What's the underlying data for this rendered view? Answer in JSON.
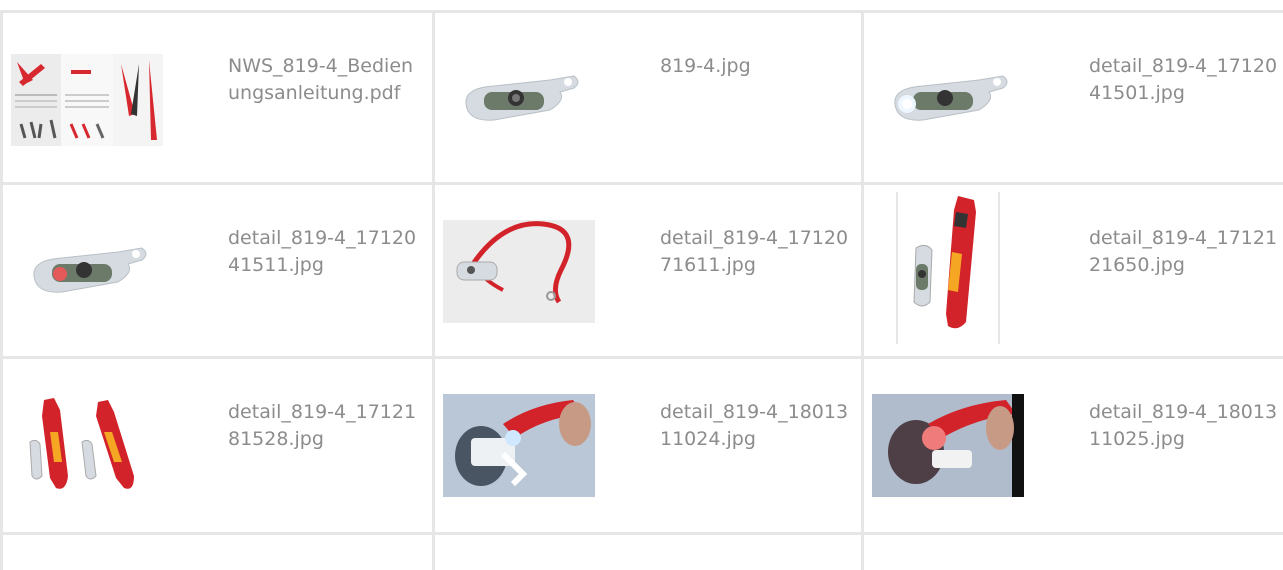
{
  "files": [
    {
      "name": "NWS_819-4_Bedienungsanleitung.pdf",
      "thumb": "pdf-manual-thumbnail"
    },
    {
      "name": "819-4.jpg",
      "thumb": "tester-clip-thumbnail"
    },
    {
      "name": "detail_819-4_1712041501.jpg",
      "thumb": "tester-led-white-thumbnail"
    },
    {
      "name": "detail_819-4_1712041511.jpg",
      "thumb": "tester-led-red-thumbnail"
    },
    {
      "name": "detail_819-4_1712071611.jpg",
      "thumb": "tester-lanyard-thumbnail"
    },
    {
      "name": "detail_819-4_1712121650.jpg",
      "thumb": "tester-with-tool-thumbnail"
    },
    {
      "name": "detail_819-4_1712181528.jpg",
      "thumb": "two-tools-thumbnail"
    },
    {
      "name": "detail_819-4_1801311024.jpg",
      "thumb": "outlet-test-blue-thumbnail"
    },
    {
      "name": "detail_819-4_1801311025.jpg",
      "thumb": "outlet-test-red-thumbnail"
    }
  ],
  "colors": {
    "grid": "#e6e6e6",
    "text": "#8c8c8c",
    "accent": "#d8282f"
  }
}
